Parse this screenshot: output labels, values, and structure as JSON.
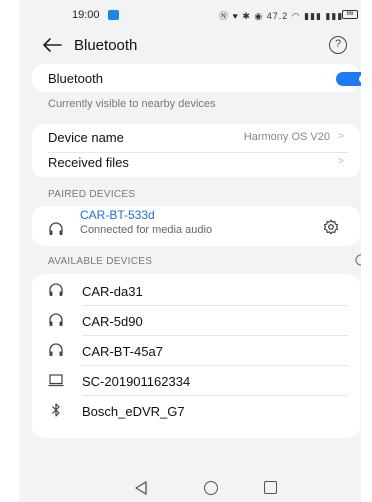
{
  "status_bar": {
    "time": "19:00",
    "icons_text": "Ⓝ ♥ ✱ ◉ 47.2  ◠ ▮▮▮ ▮▮▮",
    "battery": "66"
  },
  "header": {
    "title": "Bluetooth",
    "help": "?"
  },
  "bluetooth": {
    "label": "Bluetooth",
    "enabled": true,
    "visible_note": "Currently visible to nearby devices"
  },
  "settings": {
    "device_name_label": "Device name",
    "device_name_value": "Harmony OS V20",
    "received_files_label": "Received files",
    "chevron": ">"
  },
  "paired": {
    "section_title": "PAIRED DEVICES",
    "devices": [
      {
        "name": "CAR-BT-533d",
        "status": "Connected for media audio",
        "icon": "headphones-icon"
      }
    ]
  },
  "available": {
    "section_title": "AVAILABLE DEVICES",
    "devices": [
      {
        "name": "CAR-da31",
        "icon": "headphones-icon"
      },
      {
        "name": "CAR-5d90",
        "icon": "headphones-icon"
      },
      {
        "name": "CAR-BT-45a7",
        "icon": "headphones-icon"
      },
      {
        "name": "SC-201901162334",
        "icon": "laptop-icon"
      },
      {
        "name": "Bosch_eDVR_G7",
        "icon": "bluetooth-icon"
      }
    ]
  },
  "colors": {
    "accent": "#1e7bf5",
    "link": "#1e6fd9",
    "background": "#f1f3f5"
  }
}
